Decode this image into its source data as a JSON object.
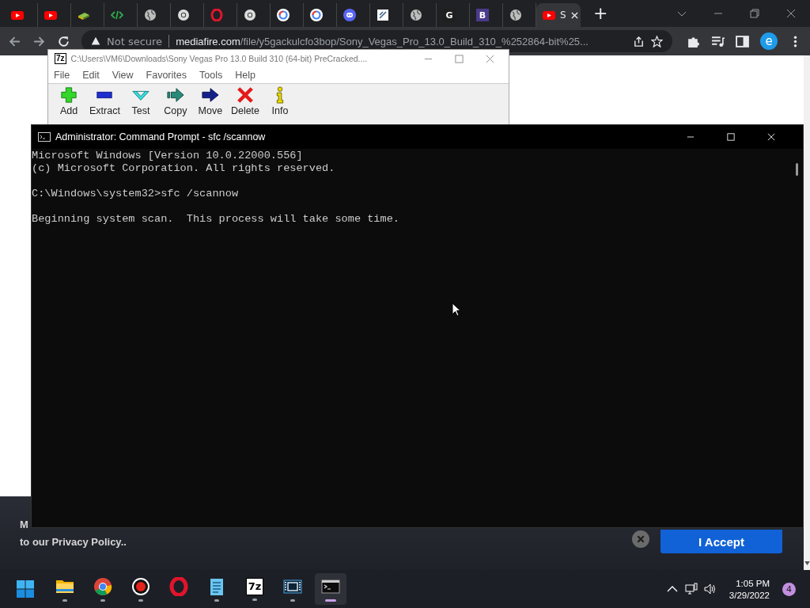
{
  "browser": {
    "tabs": [
      {
        "kind": "youtube",
        "selected": false
      },
      {
        "kind": "youtube",
        "selected": false
      },
      {
        "kind": "book",
        "selected": false
      },
      {
        "kind": "code",
        "selected": false
      },
      {
        "kind": "globe",
        "selected": false
      },
      {
        "kind": "chrome",
        "selected": false
      },
      {
        "kind": "opera",
        "selected": false
      },
      {
        "kind": "chrome",
        "selected": false
      },
      {
        "kind": "google",
        "selected": false
      },
      {
        "kind": "google",
        "selected": false
      },
      {
        "kind": "discord",
        "selected": false
      },
      {
        "kind": "doc",
        "selected": false
      },
      {
        "kind": "globe",
        "selected": false
      },
      {
        "kind": "letter",
        "letter": "G",
        "color": "#1f1f1f",
        "selected": false
      },
      {
        "kind": "letter",
        "letter": "B",
        "color": "#4b3a8c",
        "selected": false
      },
      {
        "kind": "globe",
        "selected": false
      },
      {
        "kind": "youtube",
        "title": "S",
        "selected": true
      }
    ],
    "new_tab": "+",
    "address": {
      "security": "Not secure",
      "domain": "mediafire.com",
      "path": "/file/y5gackulcfo3bop/Sony_Vegas_Pro_13.0_Build_310_%252864-bit%25..."
    },
    "profile_letter": "e",
    "cookie_banner": {
      "line_1": "M",
      "line_2": "to our Privacy Policy..",
      "accept": "I Accept"
    }
  },
  "archiver": {
    "app_icon": "7z",
    "title": "C:\\Users\\VM6\\Downloads\\Sony Vegas Pro 13.0 Build 310 (64-bit) PreCracked....",
    "menu": [
      "File",
      "Edit",
      "View",
      "Favorites",
      "Tools",
      "Help"
    ],
    "toolbar": [
      {
        "kind": "add",
        "label": "Add"
      },
      {
        "kind": "extract",
        "label": "Extract"
      },
      {
        "kind": "test",
        "label": "Test"
      },
      {
        "kind": "copy",
        "label": "Copy"
      },
      {
        "kind": "move",
        "label": "Move"
      },
      {
        "kind": "delete",
        "label": "Delete"
      },
      {
        "kind": "info",
        "label": "Info"
      }
    ]
  },
  "console": {
    "title": "Administrator: Command Prompt - sfc  /scannow",
    "blocks": [
      [
        "Microsoft Windows [Version 10.0.22000.556]",
        "(c) Microsoft Corporation. All rights reserved."
      ],
      [
        "C:\\Windows\\system32>sfc /scannow"
      ],
      [
        "Beginning system scan.  This process will take some time."
      ]
    ]
  },
  "taskbar": {
    "apps": [
      {
        "kind": "folder",
        "running": true,
        "selected": false
      },
      {
        "kind": "chrome",
        "running": true,
        "selected": false
      },
      {
        "kind": "record",
        "running": true,
        "selected": false
      },
      {
        "kind": "opera",
        "running": false,
        "selected": false
      },
      {
        "kind": "notepad",
        "running": true,
        "selected": false
      },
      {
        "kind": "archiver",
        "text": "7z",
        "running": true,
        "selected": false
      },
      {
        "kind": "film",
        "running": true,
        "selected": false
      },
      {
        "kind": "terminal",
        "running": true,
        "selected": true
      }
    ],
    "time": "1:05 PM",
    "date": "3/29/2022",
    "notifications": "4"
  }
}
